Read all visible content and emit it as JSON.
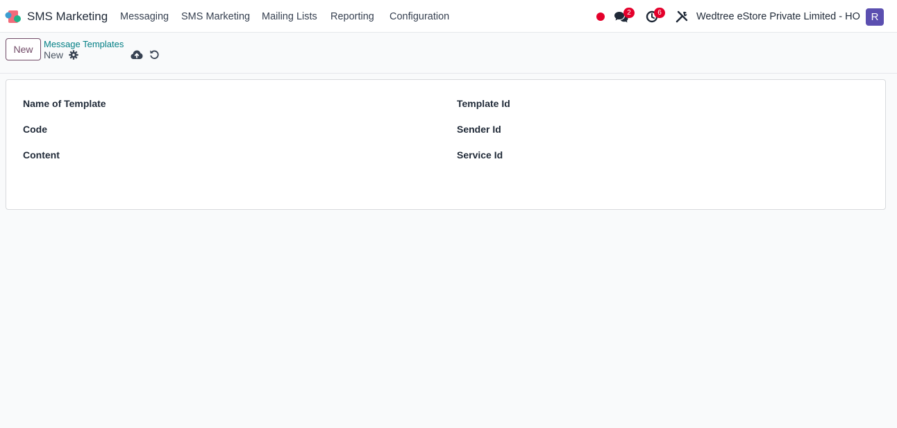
{
  "app": {
    "name": "SMS Marketing"
  },
  "menu": {
    "items": [
      "Messaging",
      "SMS Marketing",
      "Mailing Lists",
      "Reporting",
      "Configuration"
    ]
  },
  "systray": {
    "chat_count": "2",
    "activity_count": "6",
    "company": "Wedtree eStore Private Limited - HO",
    "user_initial": "R",
    "status_color": "#e4002b"
  },
  "control": {
    "new_label": "New",
    "breadcrumb_parent": "Message Templates",
    "breadcrumb_current": "New"
  },
  "form": {
    "left_fields": [
      "Name of Template",
      "Code",
      "Content"
    ],
    "right_fields": [
      "Template Id",
      "Sender Id",
      "Service Id"
    ]
  },
  "colors": {
    "brand": "#714b67",
    "link": "#017e84",
    "avatar": "#5b4fb0",
    "badge": "#e4002b"
  },
  "icons": [
    "app-logo-icon",
    "chat-icon",
    "clock-icon",
    "tools-icon",
    "gear-icon",
    "cloud-upload-icon",
    "undo-icon"
  ]
}
